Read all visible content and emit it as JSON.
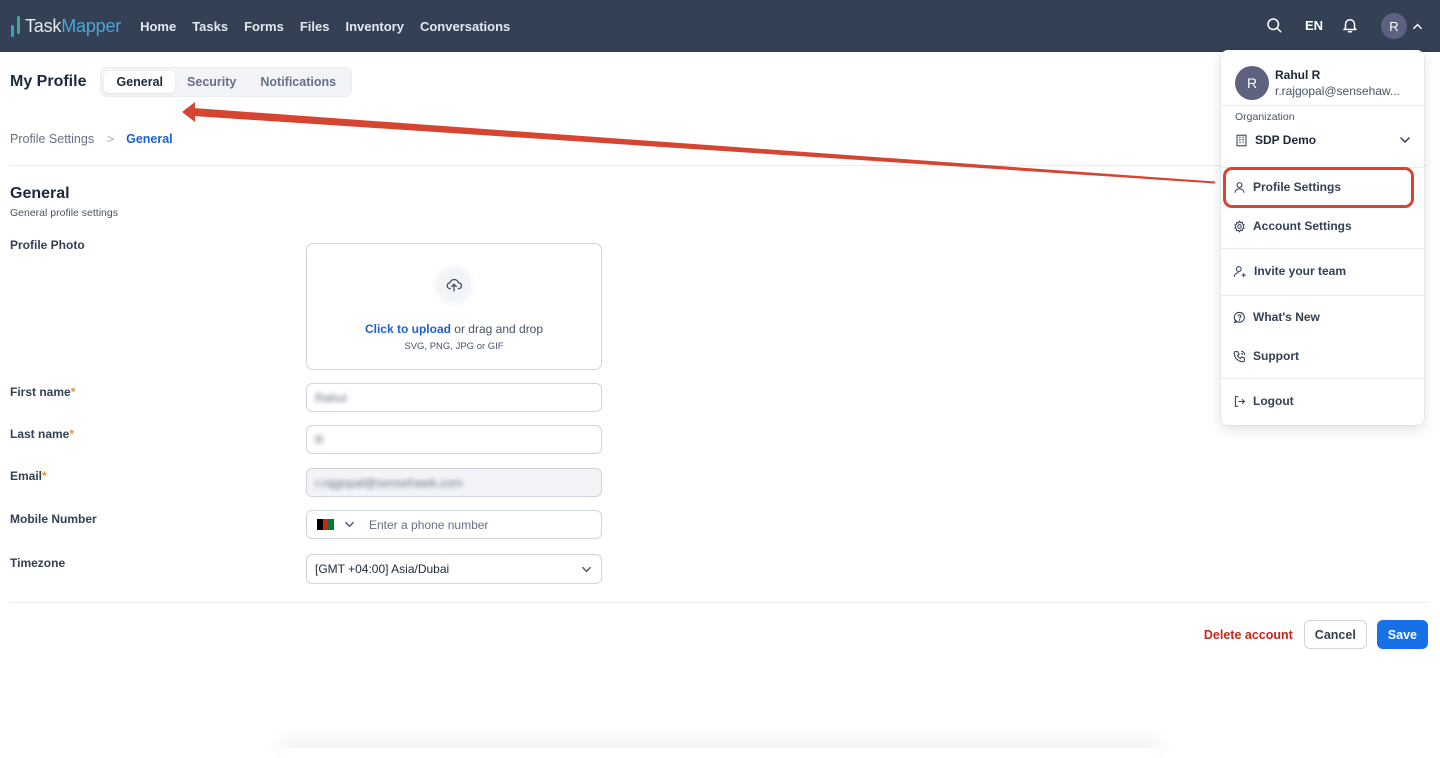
{
  "app": {
    "brand_part1": "Task",
    "brand_part2": "Mapper",
    "nav": [
      "Home",
      "Tasks",
      "Forms",
      "Files",
      "Inventory",
      "Conversations"
    ],
    "language": "EN",
    "avatar_initial": "R"
  },
  "page": {
    "title": "My Profile",
    "tabs": [
      {
        "label": "General",
        "active": true
      },
      {
        "label": "Security",
        "active": false
      },
      {
        "label": "Notifications",
        "active": false
      }
    ],
    "breadcrumb": [
      "Profile Settings",
      "General"
    ],
    "breadcrumb_separator": ">"
  },
  "section": {
    "title": "General",
    "subtitle": "General profile settings"
  },
  "form": {
    "profile_photo_label": "Profile Photo",
    "upload_link": "Click to upload",
    "upload_text": " or drag and drop",
    "upload_hint": "SVG, PNG, JPG or GIF",
    "first_name_label": "First name",
    "first_name_value": "Rahul",
    "last_name_label": "Last name",
    "last_name_value": "R",
    "email_label": "Email",
    "email_value": "r.rajgopal@sensehawk.com",
    "required_marker": "*",
    "mobile_label": "Mobile Number",
    "mobile_placeholder": "Enter a phone number",
    "mobile_country": "Afghanistan",
    "timezone_label": "Timezone",
    "timezone_value": "[GMT +04:00] Asia/Dubai"
  },
  "actions": {
    "delete": "Delete account",
    "cancel": "Cancel",
    "save": "Save"
  },
  "dropdown": {
    "avatar_initial": "R",
    "name": "Rahul R",
    "email": "r.rajgopal@sensehaw...",
    "org_label": "Organization",
    "org_name": "SDP Demo",
    "items": {
      "profile": "Profile Settings",
      "account": "Account Settings",
      "invite": "Invite your team",
      "whats_new": "What's New",
      "support": "Support",
      "logout": "Logout"
    }
  },
  "annotation": {
    "color": "#d64532",
    "highlighted_item": "Profile Settings"
  },
  "colors": {
    "topbar": "#344054",
    "accent": "#1670e8",
    "link": "#1d5fd6",
    "danger": "#c8261b"
  }
}
